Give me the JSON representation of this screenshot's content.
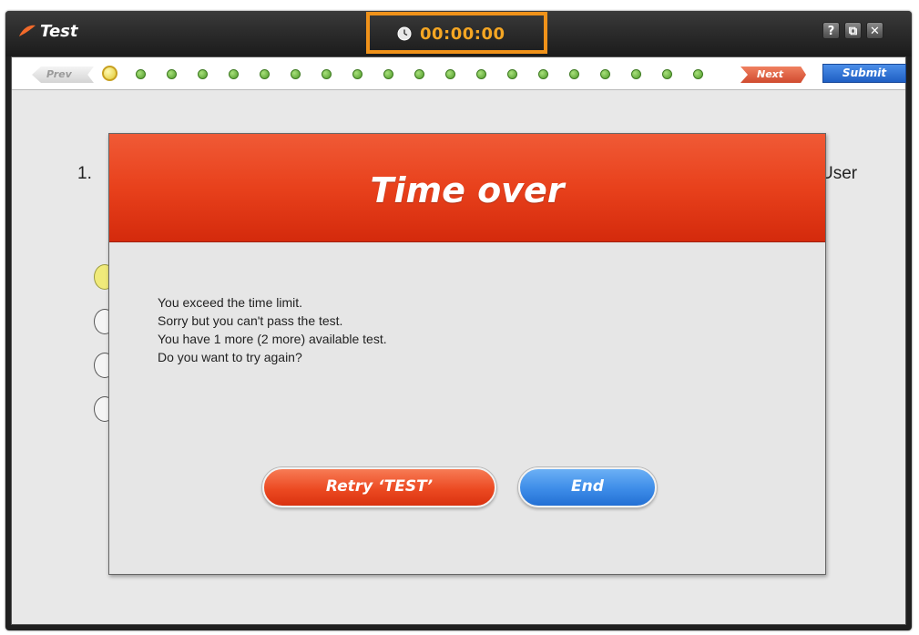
{
  "window": {
    "title": "Test",
    "timer": "00:00:00",
    "buttons": {
      "help": "?",
      "restore": "⧉",
      "close": "✕"
    }
  },
  "nav": {
    "prev_label": "Prev",
    "next_label": "Next",
    "submit_label": "Submit",
    "question_count": 20,
    "current_question": 1
  },
  "question": {
    "number": "1.",
    "tail_text": "User",
    "options_count": 4,
    "selected_option": 1
  },
  "modal": {
    "title": "Time over",
    "lines": [
      "You exceed the time limit.",
      "Sorry but you can't pass the test.",
      "You have 1 more (2 more) available test.",
      "Do you want to try again?"
    ],
    "retry_label": "Retry ‘TEST’",
    "end_label": "End"
  },
  "colors": {
    "timer_text": "#f5a623",
    "timer_highlight": "#f0921a",
    "modal_header": "#e8411c",
    "retry_button": "#ec4a22",
    "end_button": "#3d8ce8",
    "submit_button": "#2f6fd4"
  },
  "icons": {
    "logo": "brand-logo-icon",
    "timer": "clock-icon"
  }
}
